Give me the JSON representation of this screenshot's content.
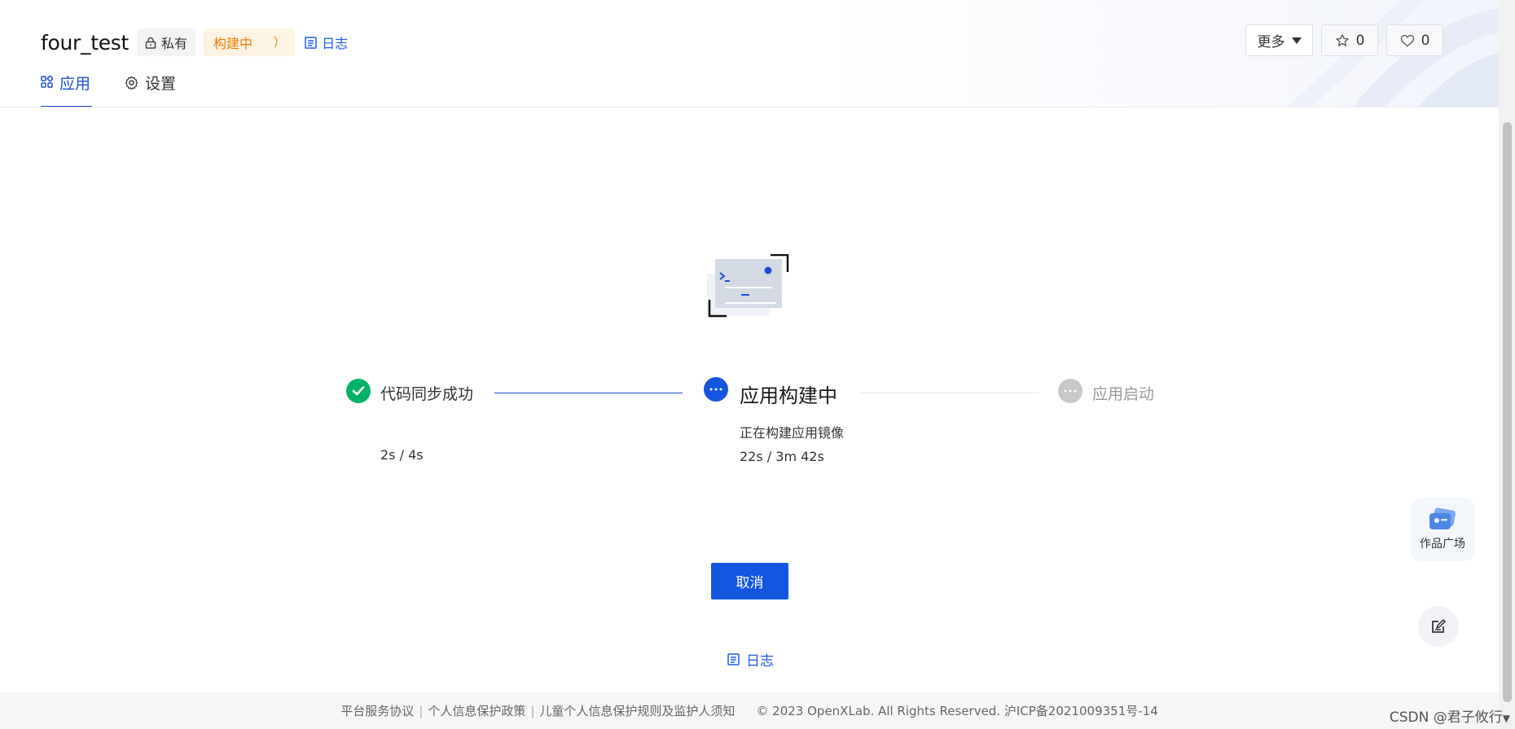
{
  "header": {
    "title": "four_test",
    "visibility_tag": "私有",
    "status_tag": "构建中",
    "status_tag_arc": "）",
    "log_link": "日志",
    "more_button": "更多",
    "star_count": "0",
    "like_count": "0"
  },
  "tabs": [
    {
      "label": "应用",
      "icon": "apps-icon",
      "active": true
    },
    {
      "label": "设置",
      "icon": "gear-icon",
      "active": false
    }
  ],
  "steps": [
    {
      "title": "代码同步成功",
      "status": "success",
      "detail": "",
      "time": "2s / 4s"
    },
    {
      "title": "应用构建中",
      "status": "in-progress",
      "detail": "正在构建应用镜像",
      "time": "22s / 3m 42s"
    },
    {
      "title": "应用启动",
      "status": "pending",
      "detail": "",
      "time": ""
    }
  ],
  "actions": {
    "cancel_label": "取消",
    "log_label": "日志"
  },
  "floating": {
    "gallery_label": "作品广场"
  },
  "footer": {
    "links": [
      "平台服务协议",
      "个人信息保护政策",
      "儿童个人信息保护规则及监护人须知"
    ],
    "copyright": "© 2023 OpenXLab. All Rights Reserved. 沪ICP备2021009351号-14"
  },
  "watermark": "CSDN @君子攸行",
  "colors": {
    "accent": "#1456e0",
    "success": "#00b365",
    "building": "#f07c00",
    "pending": "#c8c8c8"
  }
}
